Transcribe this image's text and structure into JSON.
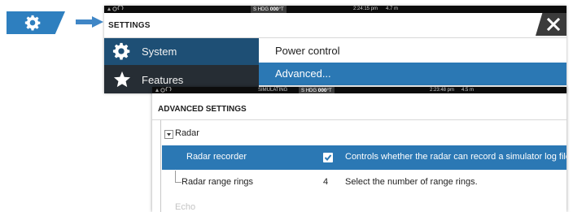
{
  "shortcut": {
    "key_label": "Settings key"
  },
  "settings_window": {
    "status": {
      "heading_prefix": "S",
      "heading_label": "HDG",
      "heading_value": "000",
      "heading_unit": "°T",
      "time": "2:24:15 pm",
      "depth": "4.7 m"
    },
    "title": "SETTINGS",
    "nav": [
      {
        "label": "System"
      },
      {
        "label": "Features"
      }
    ],
    "menu": [
      {
        "label": "Power control"
      },
      {
        "label": "Advanced..."
      }
    ]
  },
  "advanced_window": {
    "status": {
      "mode": "SIMULATING",
      "heading_prefix": "S",
      "heading_label": "HDG",
      "heading_value": "000",
      "heading_unit": "°T",
      "time": "2:23:48 pm",
      "depth": "4.5 m"
    },
    "title": "ADVANCED SETTINGS",
    "group": {
      "label": "Radar"
    },
    "rows": [
      {
        "label": "Radar recorder",
        "value": "checked",
        "description": "Controls whether the radar can record a simulator log file."
      },
      {
        "label": "Radar range rings",
        "value": "4",
        "description": "Select the number of range rings."
      }
    ],
    "next_group": {
      "label": "Echo"
    }
  },
  "colors": {
    "accent": "#2b78b4",
    "key_blue": "#2e7fbf",
    "nav_dark": "#2c343d",
    "nav_selected": "#1e4f75"
  }
}
